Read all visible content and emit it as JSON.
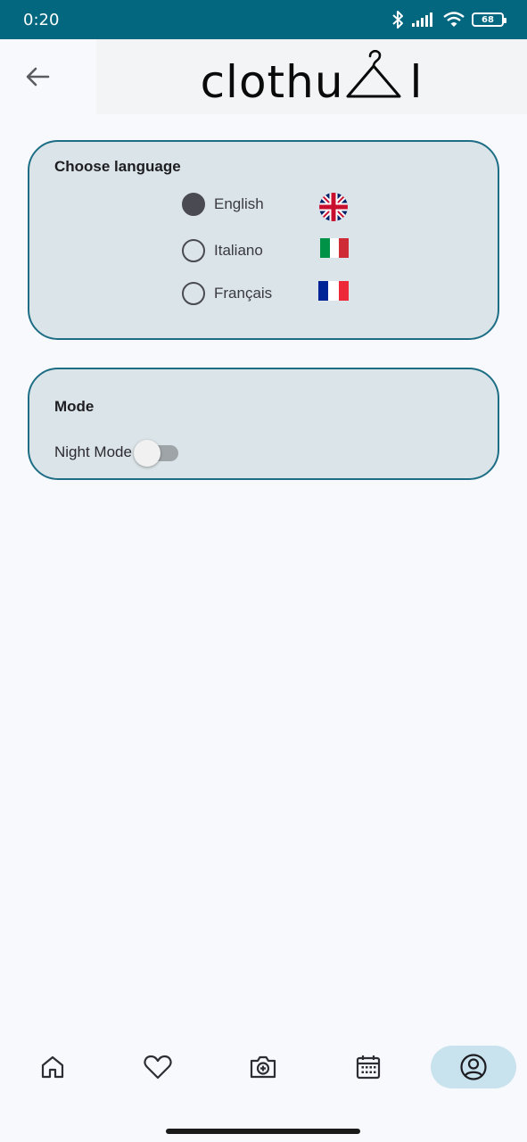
{
  "status_bar": {
    "time": "0:20",
    "battery": "68",
    "icons": [
      "bluetooth-icon",
      "signal-icon",
      "wifi-icon",
      "battery-icon"
    ]
  },
  "header": {
    "logo_text": "clothu",
    "logo_suffix": "l",
    "back_icon": "arrow-left-icon"
  },
  "language": {
    "title": "Choose language",
    "options": [
      {
        "label": "English",
        "selected": true,
        "flag": "uk-flag"
      },
      {
        "label": "Italiano",
        "selected": false,
        "flag": "italy-flag"
      },
      {
        "label": "Français",
        "selected": false,
        "flag": "france-flag"
      }
    ]
  },
  "mode": {
    "title": "Mode",
    "night_label": "Night Mode",
    "night_enabled": false
  },
  "nav": {
    "items": [
      {
        "icon": "home-icon",
        "active": false
      },
      {
        "icon": "heart-icon",
        "active": false
      },
      {
        "icon": "camera-add-icon",
        "active": false
      },
      {
        "icon": "calendar-icon",
        "active": false
      },
      {
        "icon": "profile-icon",
        "active": true
      }
    ]
  },
  "colors": {
    "status_bar": "#02677f",
    "card_border": "#1d6e85",
    "card_bg": "#dbe4e8",
    "nav_active_bg": "#c9e3ee"
  }
}
